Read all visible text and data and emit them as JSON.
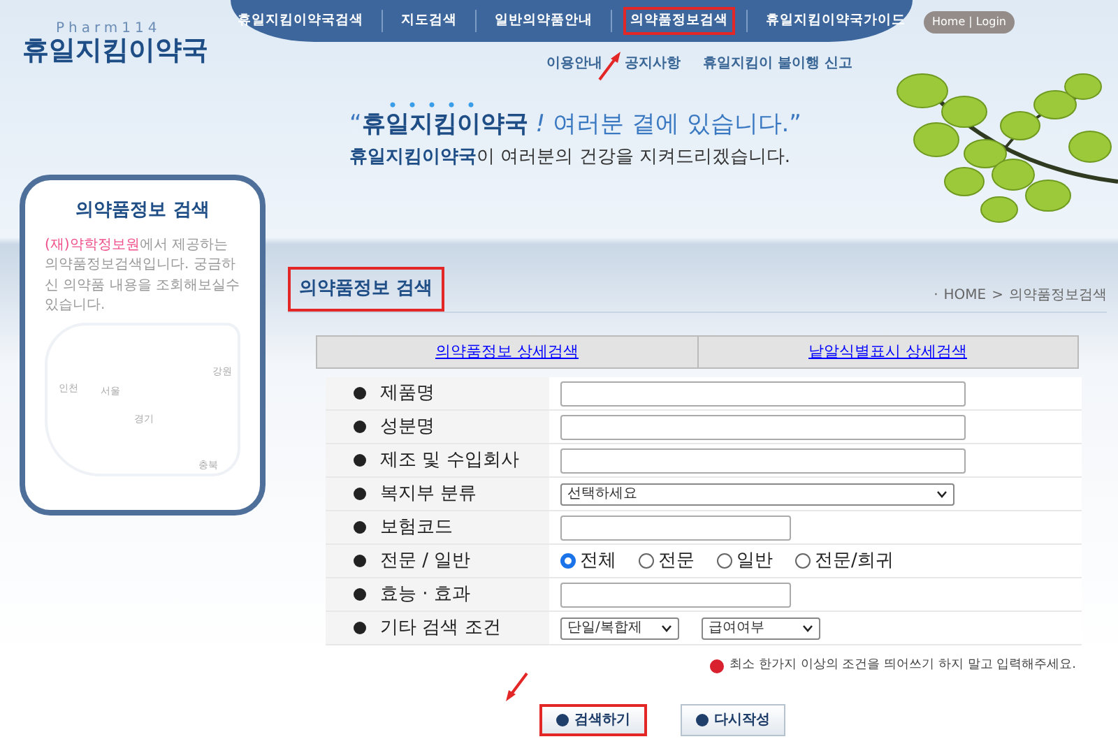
{
  "logo": {
    "tagline": "Pharm114",
    "name": "휴일지킴이약국"
  },
  "nav": [
    {
      "label": "휴일지킴이약국검색",
      "highlighted": false
    },
    {
      "label": "지도검색",
      "highlighted": false
    },
    {
      "label": "일반의약품안내",
      "highlighted": false
    },
    {
      "label": "의약품정보검색",
      "highlighted": true
    },
    {
      "label": "휴일지킴이약국가이드",
      "highlighted": false
    }
  ],
  "account_link": "Home | Login",
  "sub_nav": [
    "이용안내",
    "공지사항",
    "휴일지킴이 불이행 신고"
  ],
  "slogan": {
    "line1": "“**휴일지킴이약국** *!* 여러분 곁에 있습니다.”",
    "line2": "**휴일지킴이약국**이 여러분의 건강을 지켜드리겠습니다."
  },
  "sidebar": {
    "title": "의약품정보 검색",
    "text": "(재)약학정보원",
    "text_rest": "에서 제공하는 의약품정보검색입니다. 궁금하신 의약품 내용을 조회해보실수 있습니다.",
    "map_labels": [
      "인천",
      "서울",
      "경기",
      "강원",
      "충북"
    ]
  },
  "page": {
    "title": "의약품정보 검색",
    "highlighted": true,
    "breadcrumb": [
      "·",
      "HOME",
      ">",
      "의약품정보검색"
    ]
  },
  "tabs": [
    {
      "label": "의약품정보 상세검색"
    },
    {
      "label": "낱알식별표시 상세검색"
    }
  ],
  "form": [
    {
      "label": "제품명",
      "kind": "wide"
    },
    {
      "label": "성분명",
      "kind": "wide"
    },
    {
      "label": "제조 및 수입회사",
      "kind": "wide"
    },
    {
      "label": "복지부 분류",
      "kind": "select",
      "value": "선택하세요"
    },
    {
      "label": "보험코드",
      "kind": "narrow"
    },
    {
      "label": "전문 / 일반",
      "kind": "radio",
      "options": [
        {
          "label": "전체",
          "selected": true
        },
        {
          "label": "전문",
          "selected": false
        },
        {
          "label": "일반",
          "selected": false
        },
        {
          "label": "전문/희귀",
          "selected": false
        }
      ]
    },
    {
      "label": "효능 · 효과",
      "kind": "narrow"
    },
    {
      "label": "기타 검색 조건",
      "kind": "selects",
      "values": [
        "단일/복합제",
        "급여여부"
      ]
    }
  ],
  "notice": "최소 한가지 이상의 조건을 띄어쓰기 하지 말고 입력해주세요.",
  "buttons": [
    {
      "label": "검색하기",
      "highlighted": true
    },
    {
      "label": "다시작성",
      "highlighted": false
    }
  ]
}
